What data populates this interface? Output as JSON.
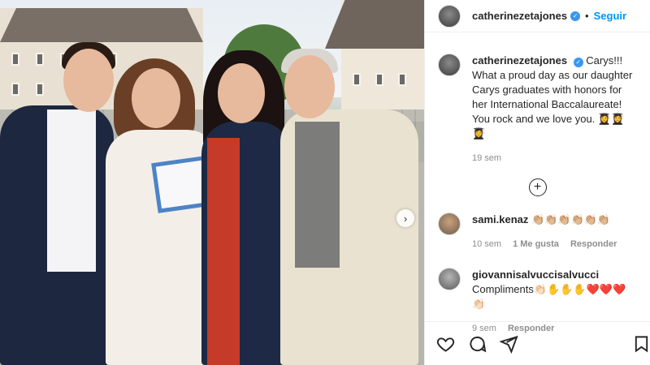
{
  "post": {
    "username": "catherinezetajones",
    "follow_label": "Seguir",
    "dot": "•",
    "caption_text": "Carys!!! What a proud day as our daughter Carys graduates with honors for her International Baccalaureate! You rock and we love you. 👩‍🎓👩‍🎓👩‍🎓",
    "caption_time": "19 sem",
    "next_label": "›"
  },
  "comments": [
    {
      "username": "sami.kenaz",
      "text": "👏🏼👏🏼👏🏼👏🏼👏🏼👏🏼",
      "time": "10 sem",
      "likes": "1 Me gusta",
      "reply": "Responder"
    },
    {
      "username": "giovannisalvuccisalvucci",
      "text": "Compliments👏🏻✋✋✋❤️❤️❤️👏🏻",
      "time": "9 sem",
      "reply": "Responder"
    }
  ],
  "icons": {
    "like": "heart-icon",
    "comment": "comment-icon",
    "share": "share-icon",
    "save": "bookmark-icon",
    "load_more": "plus-circle-icon"
  },
  "colors": {
    "follow": "#0095f6",
    "verified": "#3897f0",
    "meta": "#8e8e8e"
  }
}
